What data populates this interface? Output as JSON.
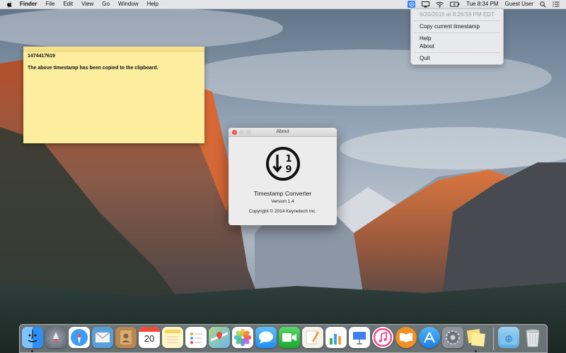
{
  "menubar": {
    "app_name": "Finder",
    "menus": [
      "File",
      "Edit",
      "View",
      "Go",
      "Window"
    ],
    "help": "Help",
    "clock": "Tue 8:34 PM",
    "user": "Guest User",
    "icons": [
      "apple-icon",
      "timestamp-status-icon",
      "airplay-icon",
      "wifi-icon",
      "battery-icon",
      "search-icon",
      "notification-center-icon"
    ]
  },
  "dropdown": {
    "current_time": "9/20/2016 at 8:26:59 PM EDT",
    "copy": "Copy current timestamp",
    "help": "Help",
    "about": "About",
    "quit": "Quit"
  },
  "sticky": {
    "timestamp": "1474417619",
    "message": "The above timestamp has been copied to the clipboard."
  },
  "about": {
    "title": "About",
    "logo_digits": [
      "1",
      "9"
    ],
    "app_name": "Timestamp Converter",
    "version": "Version 1.4",
    "copyright": "Copyright © 2014 Keynetech Inc."
  },
  "dock": {
    "calendar_day": "20",
    "apps": [
      "finder",
      "launchpad",
      "safari",
      "mail",
      "contacts",
      "calendar",
      "notes",
      "reminders",
      "maps",
      "photos",
      "messages",
      "facetime",
      "pages",
      "numbers",
      "keynote",
      "itunes",
      "ibooks",
      "app-store",
      "system-preferences",
      "stickies",
      "downloads",
      "trash"
    ]
  },
  "colors": {
    "accent": "#2d7ff0",
    "sticky": "#fcee9e",
    "close": "#fc5f57"
  }
}
